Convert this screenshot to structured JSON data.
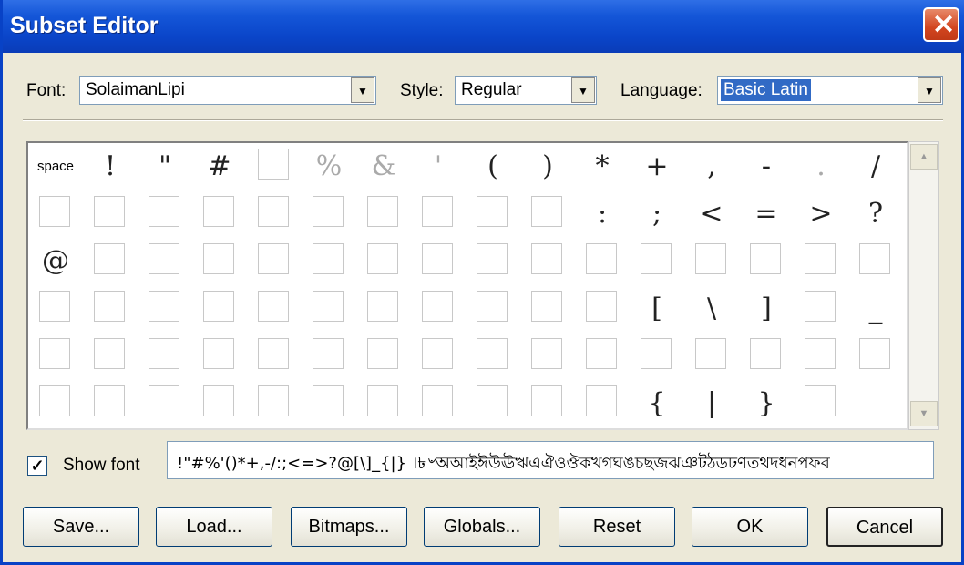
{
  "window": {
    "title": "Subset Editor",
    "close_glyph": "✕"
  },
  "font_selector": {
    "label": "Font:",
    "value": "SolaimanLipi"
  },
  "style_selector": {
    "label": "Style:",
    "value": "Regular"
  },
  "language_selector": {
    "label": "Language:",
    "value": "Basic Latin"
  },
  "dropdown_glyph": "▼",
  "glyph_grid": {
    "space_label": "space",
    "glyphs": [
      "!",
      "\"",
      "#",
      "%",
      "&",
      "'",
      "(",
      ")",
      "*",
      "+",
      ",",
      "-",
      ".",
      "/",
      ":",
      ";",
      "<",
      "=",
      ">",
      "?",
      "@",
      "[",
      "\\",
      "]",
      "_",
      "{",
      "|",
      "}"
    ]
  },
  "scrollbar": {
    "up_glyph": "▲",
    "down_glyph": "▼"
  },
  "show_font": {
    "label": "Show font",
    "checked": true,
    "check_glyph": "✓"
  },
  "preview_text": "!\"#%'()*+,-/:;<=>?@[\\]_{|} ।৳৺অআইঈউঊঋএঐওঔকখগঘঙচছজঝঞটঠডঢণতথদধনপফব",
  "buttons": {
    "save": "Save...",
    "load": "Load...",
    "bitmaps": "Bitmaps...",
    "globals": "Globals...",
    "reset": "Reset",
    "ok": "OK",
    "cancel": "Cancel"
  }
}
